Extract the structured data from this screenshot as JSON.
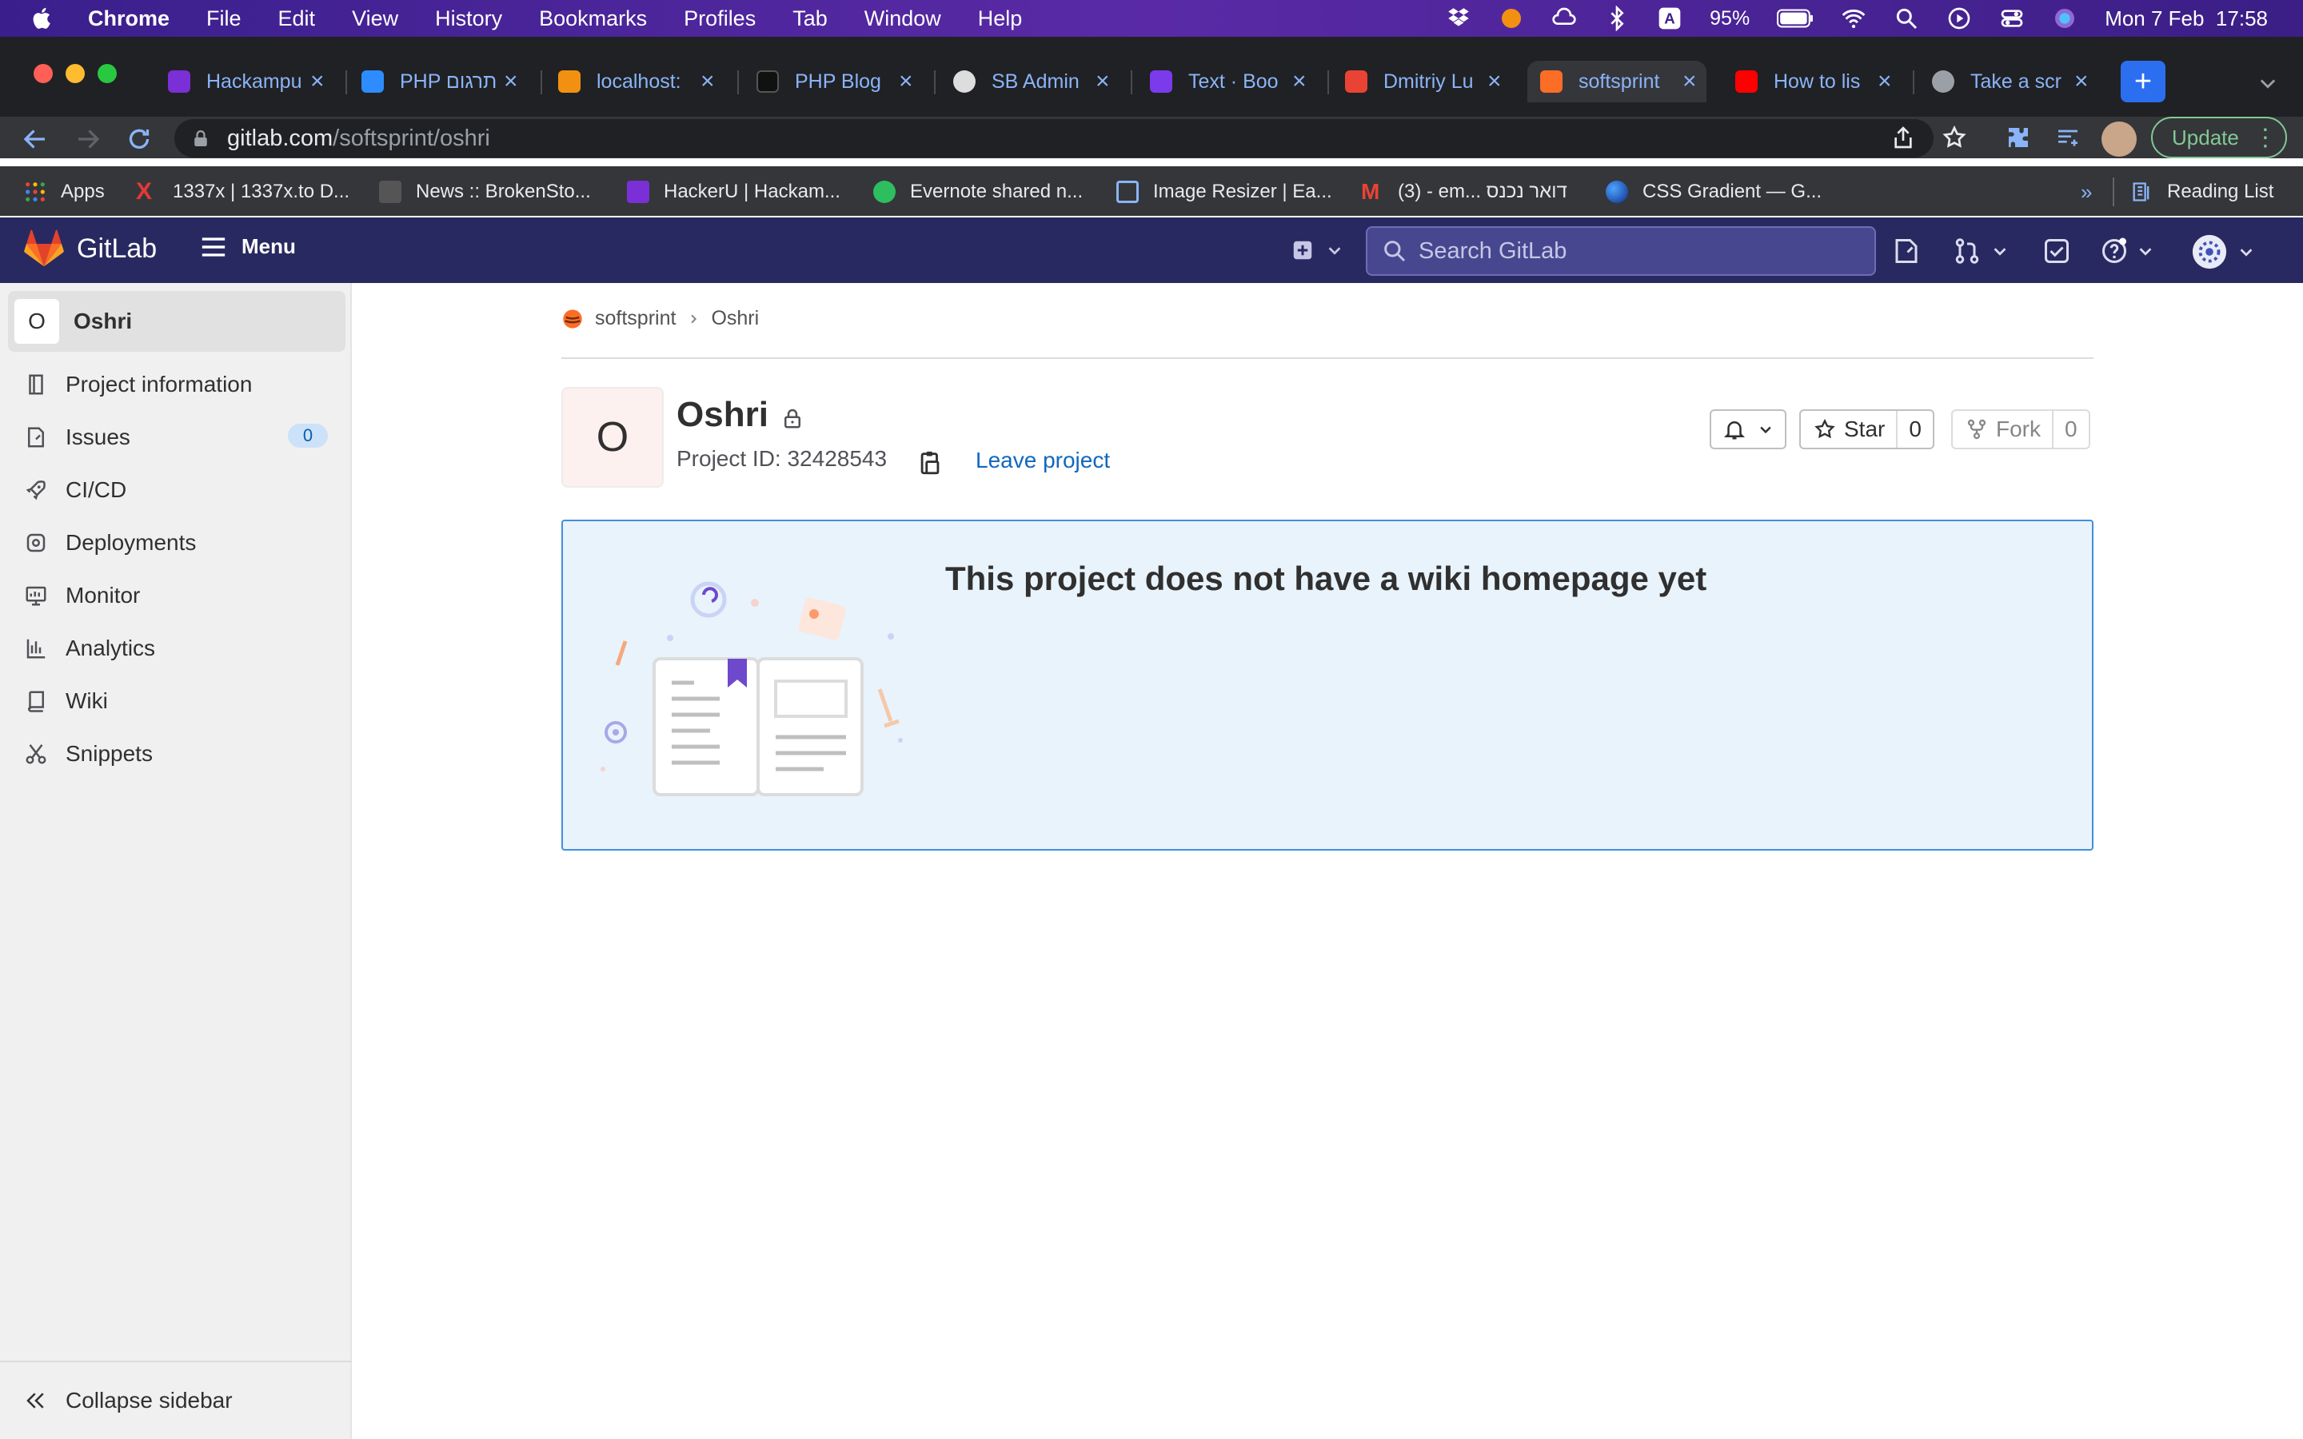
{
  "macos": {
    "app": "Chrome",
    "menu": [
      "File",
      "Edit",
      "View",
      "History",
      "Bookmarks",
      "Profiles",
      "Tab",
      "Window",
      "Help"
    ],
    "battery": "95%",
    "datetime": "Mon 7 Feb  17:58"
  },
  "tabs": [
    {
      "label": "Hackampu",
      "color": "#7b2fd6"
    },
    {
      "label": "PHP תרגום",
      "color": "#2d8cff"
    },
    {
      "label": "localhost:",
      "color": "#f29111"
    },
    {
      "label": "PHP Blog",
      "color": "#111111"
    },
    {
      "label": "SB Admin",
      "color": "#dddddd"
    },
    {
      "label": "Text · Boo",
      "color": "#7c3aed"
    },
    {
      "label": "Dmitriy Lu",
      "color": "#ea4335"
    },
    {
      "label": "softsprint",
      "color": "#fc6d26"
    },
    {
      "label": "How to lis",
      "color": "#ff0000"
    },
    {
      "label": "Take a scr",
      "color": "#9aa0a6"
    }
  ],
  "address": {
    "domain": "gitlab.com",
    "path": "/softsprint/oshri"
  },
  "update_label": "Update",
  "bookmarks": [
    {
      "label": "Apps",
      "color": "#ea4335"
    },
    {
      "label": "1337x | 1337x.to D...",
      "color": "#e53935"
    },
    {
      "label": "News :: BrokenSto...",
      "color": "#555555"
    },
    {
      "label": "HackerU | Hackam...",
      "color": "#7b2fd6"
    },
    {
      "label": "Evernote shared n...",
      "color": "#2dbe60"
    },
    {
      "label": "Image Resizer | Ea...",
      "color": "#8ab4f8"
    },
    {
      "label": "(3) - em... דואר נכנס",
      "color": "#ea4335"
    },
    {
      "label": "CSS Gradient — G...",
      "color": "#1e66f5"
    }
  ],
  "reading_list": "Reading List",
  "gitlab": {
    "brand": "GitLab",
    "menu_label": "Menu",
    "search_placeholder": "Search GitLab"
  },
  "sidebar": {
    "project_initial": "O",
    "project_name": "Oshri",
    "items": [
      {
        "label": "Project information",
        "icon": "project-icon"
      },
      {
        "label": "Issues",
        "icon": "issues-icon",
        "badge": "0"
      },
      {
        "label": "CI/CD",
        "icon": "rocket-icon"
      },
      {
        "label": "Deployments",
        "icon": "deployments-icon"
      },
      {
        "label": "Monitor",
        "icon": "monitor-icon"
      },
      {
        "label": "Analytics",
        "icon": "chart-icon"
      },
      {
        "label": "Wiki",
        "icon": "book-icon"
      },
      {
        "label": "Snippets",
        "icon": "scissors-icon"
      }
    ],
    "collapse_label": "Collapse sidebar"
  },
  "breadcrumb": {
    "group": "softsprint",
    "project": "Oshri"
  },
  "project": {
    "initial": "O",
    "name": "Oshri",
    "id_label": "Project ID: 32428543",
    "leave_label": "Leave project",
    "star_label": "Star",
    "star_count": "0",
    "fork_label": "Fork",
    "fork_count": "0"
  },
  "wiki": {
    "empty_title": "This project does not have a wiki homepage yet"
  },
  "colors": {
    "nav": "#292961",
    "accent": "#1068bf",
    "badge": "#cbe2f9"
  }
}
